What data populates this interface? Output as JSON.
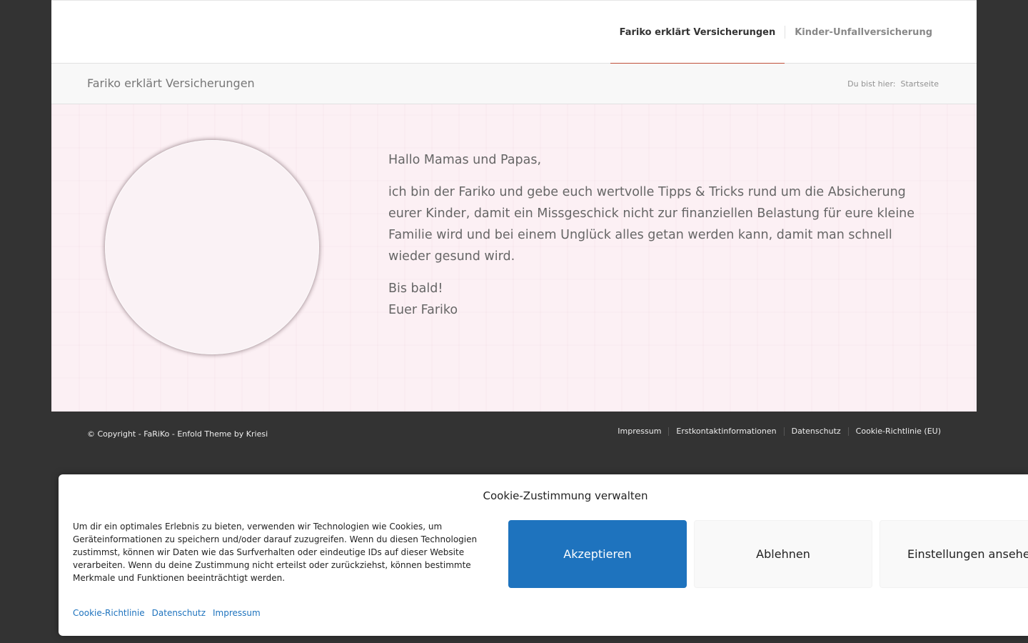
{
  "header": {
    "nav": [
      {
        "label": "Fariko erklärt Versicherungen",
        "active": true
      },
      {
        "label": "Kinder-Unfallversicherung",
        "active": false
      }
    ]
  },
  "titlebar": {
    "title": "Fariko erklärt Versicherungen",
    "breadcrumb_prefix": "Du bist hier:",
    "breadcrumb_home": "Startseite"
  },
  "main": {
    "greeting": "Hallo Mamas und Papas,",
    "body": "ich bin der Fariko und gebe euch wertvolle Tipps & Tricks rund um die Absicherung eurer Kinder, damit ein Missgeschick nicht zur finanziellen Belastung für eure kleine Familie wird und bei einem Unglück alles getan werden kann, damit man schnell wieder gesund wird.",
    "signoff_1": "Bis bald!",
    "signoff_2": "Euer Fariko"
  },
  "footer": {
    "copyright": "© Copyright - FaRiKo - Enfold Theme by Kriesi",
    "links": [
      "Impressum",
      "Erstkontaktinformationen",
      "Datenschutz",
      "Cookie-Richtlinie (EU)"
    ]
  },
  "cookie": {
    "title": "Cookie-Zustimmung verwalten",
    "text": "Um dir ein optimales Erlebnis zu bieten, verwenden wir Technologien wie Cookies, um Geräteinformationen zu speichern und/oder darauf zuzugreifen. Wenn du diesen Technologien zustimmst, können wir Daten wie das Surfverhalten oder eindeutige IDs auf dieser Website verarbeiten. Wenn du deine Zustimmung nicht erteilst oder zurückziehst, können bestimmte Merkmale und Funktionen beeinträchtigt werden.",
    "accept_label": "Akzeptieren",
    "deny_label": "Ablehnen",
    "settings_label": "Einstellungen ansehen",
    "links": [
      "Cookie-Richtlinie",
      "Datenschutz",
      "Impressum"
    ]
  },
  "colors": {
    "accent": "#c0503a",
    "button_blue": "#1e73be",
    "page_background": "#333333",
    "main_background": "#fcf0f4"
  }
}
